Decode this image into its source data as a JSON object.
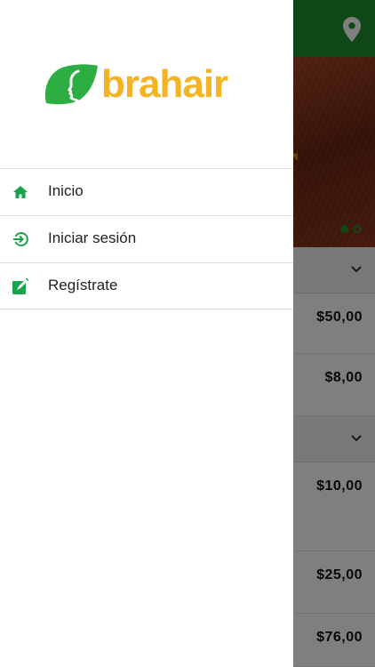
{
  "brand": {
    "name": "brahair"
  },
  "drawer": {
    "items": [
      {
        "label": "Inicio",
        "icon": "home-icon"
      },
      {
        "label": "Iniciar sesión",
        "icon": "login-icon"
      },
      {
        "label": "Regístrate",
        "icon": "edit-icon"
      }
    ]
  },
  "background": {
    "topbar_icon": "location-pin-icon",
    "banner_letter": "r",
    "prices": [
      "$50,00",
      "$8,00",
      "$10,00",
      "$25,00",
      "$76,00"
    ]
  },
  "colors": {
    "brand_green": "#1f8f2e",
    "logo_green": "#2cae43",
    "logo_yellow": "#f5b324",
    "menu_icon_green": "#1aa34a",
    "overlay": "rgba(0,0,0,0.5)"
  }
}
